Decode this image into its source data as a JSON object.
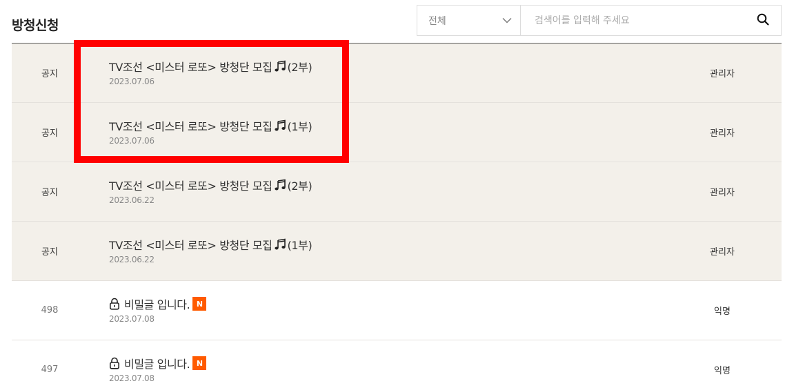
{
  "board": {
    "title": "방청신청"
  },
  "search": {
    "selected_option": "전체",
    "placeholder": "검색어를 입력해 주세요"
  },
  "rows": [
    {
      "number": "공지",
      "title": "TV조선 <미스터 로또> 방청단 모집",
      "suffix": "(2부)",
      "date": "2023.07.06",
      "author": "관리자"
    },
    {
      "number": "공지",
      "title": "TV조선 <미스터 로또> 방청단 모집",
      "suffix": "(1부)",
      "date": "2023.07.06",
      "author": "관리자"
    },
    {
      "number": "공지",
      "title": "TV조선 <미스터 로또> 방청단 모집",
      "suffix": "(2부)",
      "date": "2023.06.22",
      "author": "관리자"
    },
    {
      "number": "공지",
      "title": "TV조선 <미스터 로또> 방청단 모집",
      "suffix": "(1부)",
      "date": "2023.06.22",
      "author": "관리자"
    },
    {
      "number": "498",
      "title": "비밀글 입니다.",
      "badge": "N",
      "date": "2023.07.08",
      "author": "익명"
    },
    {
      "number": "497",
      "title": "비밀글 입니다.",
      "badge": "N",
      "date": "2023.07.08",
      "author": "익명"
    }
  ],
  "colors": {
    "notice_bg": "#f3f0ea",
    "new_badge": "#ff5a00",
    "highlight": "#ff0000"
  },
  "icons": {
    "music": "music-note-icon",
    "lock": "lock-icon",
    "search": "search-icon",
    "dropdown": "chevron-down-icon"
  }
}
